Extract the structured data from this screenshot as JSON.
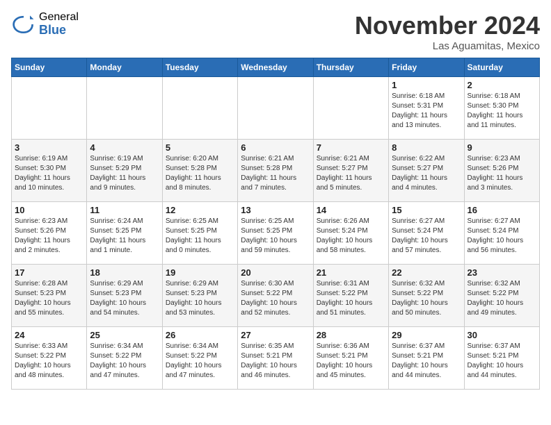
{
  "header": {
    "logo_general": "General",
    "logo_blue": "Blue",
    "month_title": "November 2024",
    "location": "Las Aguamitas, Mexico"
  },
  "weekdays": [
    "Sunday",
    "Monday",
    "Tuesday",
    "Wednesday",
    "Thursday",
    "Friday",
    "Saturday"
  ],
  "weeks": [
    [
      {
        "day": "",
        "info": ""
      },
      {
        "day": "",
        "info": ""
      },
      {
        "day": "",
        "info": ""
      },
      {
        "day": "",
        "info": ""
      },
      {
        "day": "",
        "info": ""
      },
      {
        "day": "1",
        "info": "Sunrise: 6:18 AM\nSunset: 5:31 PM\nDaylight: 11 hours\nand 13 minutes."
      },
      {
        "day": "2",
        "info": "Sunrise: 6:18 AM\nSunset: 5:30 PM\nDaylight: 11 hours\nand 11 minutes."
      }
    ],
    [
      {
        "day": "3",
        "info": "Sunrise: 6:19 AM\nSunset: 5:30 PM\nDaylight: 11 hours\nand 10 minutes."
      },
      {
        "day": "4",
        "info": "Sunrise: 6:19 AM\nSunset: 5:29 PM\nDaylight: 11 hours\nand 9 minutes."
      },
      {
        "day": "5",
        "info": "Sunrise: 6:20 AM\nSunset: 5:28 PM\nDaylight: 11 hours\nand 8 minutes."
      },
      {
        "day": "6",
        "info": "Sunrise: 6:21 AM\nSunset: 5:28 PM\nDaylight: 11 hours\nand 7 minutes."
      },
      {
        "day": "7",
        "info": "Sunrise: 6:21 AM\nSunset: 5:27 PM\nDaylight: 11 hours\nand 5 minutes."
      },
      {
        "day": "8",
        "info": "Sunrise: 6:22 AM\nSunset: 5:27 PM\nDaylight: 11 hours\nand 4 minutes."
      },
      {
        "day": "9",
        "info": "Sunrise: 6:23 AM\nSunset: 5:26 PM\nDaylight: 11 hours\nand 3 minutes."
      }
    ],
    [
      {
        "day": "10",
        "info": "Sunrise: 6:23 AM\nSunset: 5:26 PM\nDaylight: 11 hours\nand 2 minutes."
      },
      {
        "day": "11",
        "info": "Sunrise: 6:24 AM\nSunset: 5:25 PM\nDaylight: 11 hours\nand 1 minute."
      },
      {
        "day": "12",
        "info": "Sunrise: 6:25 AM\nSunset: 5:25 PM\nDaylight: 11 hours\nand 0 minutes."
      },
      {
        "day": "13",
        "info": "Sunrise: 6:25 AM\nSunset: 5:25 PM\nDaylight: 10 hours\nand 59 minutes."
      },
      {
        "day": "14",
        "info": "Sunrise: 6:26 AM\nSunset: 5:24 PM\nDaylight: 10 hours\nand 58 minutes."
      },
      {
        "day": "15",
        "info": "Sunrise: 6:27 AM\nSunset: 5:24 PM\nDaylight: 10 hours\nand 57 minutes."
      },
      {
        "day": "16",
        "info": "Sunrise: 6:27 AM\nSunset: 5:24 PM\nDaylight: 10 hours\nand 56 minutes."
      }
    ],
    [
      {
        "day": "17",
        "info": "Sunrise: 6:28 AM\nSunset: 5:23 PM\nDaylight: 10 hours\nand 55 minutes."
      },
      {
        "day": "18",
        "info": "Sunrise: 6:29 AM\nSunset: 5:23 PM\nDaylight: 10 hours\nand 54 minutes."
      },
      {
        "day": "19",
        "info": "Sunrise: 6:29 AM\nSunset: 5:23 PM\nDaylight: 10 hours\nand 53 minutes."
      },
      {
        "day": "20",
        "info": "Sunrise: 6:30 AM\nSunset: 5:22 PM\nDaylight: 10 hours\nand 52 minutes."
      },
      {
        "day": "21",
        "info": "Sunrise: 6:31 AM\nSunset: 5:22 PM\nDaylight: 10 hours\nand 51 minutes."
      },
      {
        "day": "22",
        "info": "Sunrise: 6:32 AM\nSunset: 5:22 PM\nDaylight: 10 hours\nand 50 minutes."
      },
      {
        "day": "23",
        "info": "Sunrise: 6:32 AM\nSunset: 5:22 PM\nDaylight: 10 hours\nand 49 minutes."
      }
    ],
    [
      {
        "day": "24",
        "info": "Sunrise: 6:33 AM\nSunset: 5:22 PM\nDaylight: 10 hours\nand 48 minutes."
      },
      {
        "day": "25",
        "info": "Sunrise: 6:34 AM\nSunset: 5:22 PM\nDaylight: 10 hours\nand 47 minutes."
      },
      {
        "day": "26",
        "info": "Sunrise: 6:34 AM\nSunset: 5:22 PM\nDaylight: 10 hours\nand 47 minutes."
      },
      {
        "day": "27",
        "info": "Sunrise: 6:35 AM\nSunset: 5:21 PM\nDaylight: 10 hours\nand 46 minutes."
      },
      {
        "day": "28",
        "info": "Sunrise: 6:36 AM\nSunset: 5:21 PM\nDaylight: 10 hours\nand 45 minutes."
      },
      {
        "day": "29",
        "info": "Sunrise: 6:37 AM\nSunset: 5:21 PM\nDaylight: 10 hours\nand 44 minutes."
      },
      {
        "day": "30",
        "info": "Sunrise: 6:37 AM\nSunset: 5:21 PM\nDaylight: 10 hours\nand 44 minutes."
      }
    ]
  ]
}
